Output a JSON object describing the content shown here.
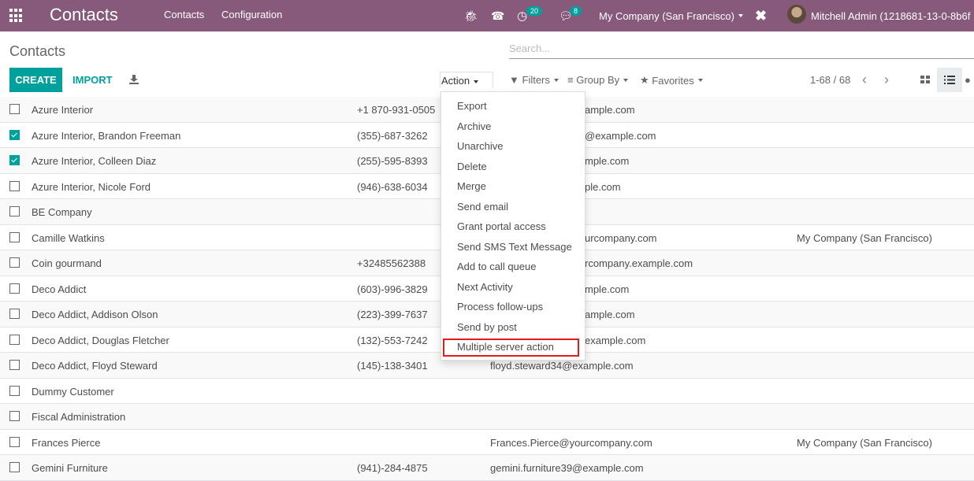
{
  "navbar": {
    "app_title": "Contacts",
    "menus": [
      "Contacts",
      "Configuration"
    ],
    "activity_count": "20",
    "message_count": "8",
    "company": "My Company (San Francisco)",
    "user": "Mitchell Admin (1218681-13-0-8b6f"
  },
  "control_panel": {
    "breadcrumb": "Contacts",
    "create_label": "CREATE",
    "import_label": "IMPORT",
    "action_label": "Action",
    "search_placeholder": "Search...",
    "filters_label": "Filters",
    "groupby_label": "Group By",
    "favorites_label": "Favorites",
    "pager": "1-68 / 68"
  },
  "action_menu": {
    "items": [
      "Export",
      "Archive",
      "Unarchive",
      "Delete",
      "Merge",
      "Send email",
      "Grant portal access",
      "Send SMS Text Message",
      "Add to call queue",
      "Next Activity",
      "Process follow-ups",
      "Send by post",
      "Multiple server action"
    ],
    "highlighted": "Multiple server action"
  },
  "rows": [
    {
      "name": "Azure Interior",
      "phone": "+1 870-931-0505",
      "email_visible": "ample.com",
      "company": "",
      "checked": false
    },
    {
      "name": "Azure Interior, Brandon Freeman",
      "phone": "(355)-687-3262",
      "email_visible": "@example.com",
      "company": "",
      "checked": true
    },
    {
      "name": "Azure Interior, Colleen Diaz",
      "phone": "(255)-595-8393",
      "email_visible": "mple.com",
      "company": "",
      "checked": true
    },
    {
      "name": "Azure Interior, Nicole Ford",
      "phone": "(946)-638-6034",
      "email_visible": "ple.com",
      "company": "",
      "checked": false
    },
    {
      "name": "BE Company",
      "phone": "",
      "email_visible": "",
      "company": "",
      "checked": false
    },
    {
      "name": "Camille Watkins",
      "phone": "",
      "email_visible": "urcompany.com",
      "company": "My Company (San Francisco)",
      "checked": false
    },
    {
      "name": "Coin gourmand",
      "phone": "+32485562388",
      "email_visible": "rcompany.example.com",
      "company": "",
      "checked": false
    },
    {
      "name": "Deco Addict",
      "phone": "(603)-996-3829",
      "email_visible": "mple.com",
      "company": "",
      "checked": false
    },
    {
      "name": "Deco Addict, Addison Olson",
      "phone": "(223)-399-7637",
      "email_visible": "ample.com",
      "company": "",
      "checked": false
    },
    {
      "name": "Deco Addict, Douglas Fletcher",
      "phone": "(132)-553-7242",
      "email_visible": "example.com",
      "company": "",
      "checked": false
    },
    {
      "name": "Deco Addict, Floyd Steward",
      "phone": "(145)-138-3401",
      "email": "floyd.steward34@example.com",
      "company": "",
      "checked": false
    },
    {
      "name": "Dummy Customer",
      "phone": "",
      "email": "",
      "company": "",
      "checked": false
    },
    {
      "name": "Fiscal Administration",
      "phone": "",
      "email": "",
      "company": "",
      "checked": false
    },
    {
      "name": "Frances Pierce",
      "phone": "",
      "email": "Frances.Pierce@yourcompany.com",
      "company": "My Company (San Francisco)",
      "checked": false
    },
    {
      "name": "Gemini Furniture",
      "phone": "(941)-284-4875",
      "email": "gemini.furniture39@example.com",
      "company": "",
      "checked": false
    }
  ]
}
